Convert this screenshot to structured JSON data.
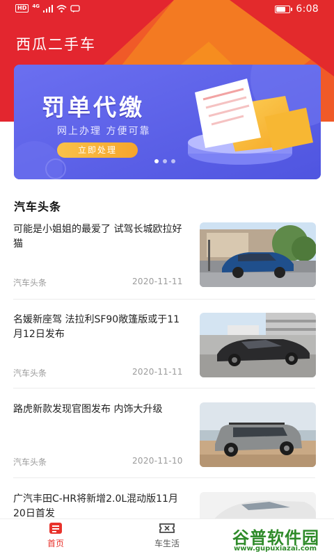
{
  "status_bar": {
    "hd": "HD",
    "network": "4G",
    "time": "6:08",
    "battery_level": 0.7
  },
  "app": {
    "title": "西瓜二手车"
  },
  "banner": {
    "title": "罚单代缴",
    "subtitle": "网上办理 方便可靠",
    "button": "立即处理",
    "dots": 3,
    "active_dot": 0,
    "accent": "#5b62ea"
  },
  "section": {
    "title": "汽车头条"
  },
  "news": [
    {
      "title": "可能是小姐姐的最爱了 试驾长城欧拉好猫",
      "source": "汽车头条",
      "date": "2020-11-11",
      "thumb": "blue-car-photo"
    },
    {
      "title": "名媛新座驾 法拉利SF90敞篷版或于11月12日发布",
      "source": "汽车头条",
      "date": "2020-11-11",
      "thumb": "camouflaged-car-photo"
    },
    {
      "title": "路虎新款发现官图发布 内饰大升级",
      "source": "汽车头条",
      "date": "2020-11-10",
      "thumb": "land-rover-photo"
    },
    {
      "title": "广汽丰田C-HR将新增2.0L混动版11月20日首发",
      "source": "",
      "date": "",
      "thumb": "white-car-photo"
    }
  ],
  "bottom_nav": [
    {
      "label": "首页",
      "icon": "home-icon",
      "active": true
    },
    {
      "label": "车生活",
      "icon": "ticket-icon",
      "active": false
    }
  ],
  "colors": {
    "primary": "#e8322b",
    "nav_active": "#e8322b",
    "nav_inactive": "#555555"
  },
  "watermark": {
    "text": "谷普软件园",
    "url": "www.gupuxiazai.com"
  }
}
